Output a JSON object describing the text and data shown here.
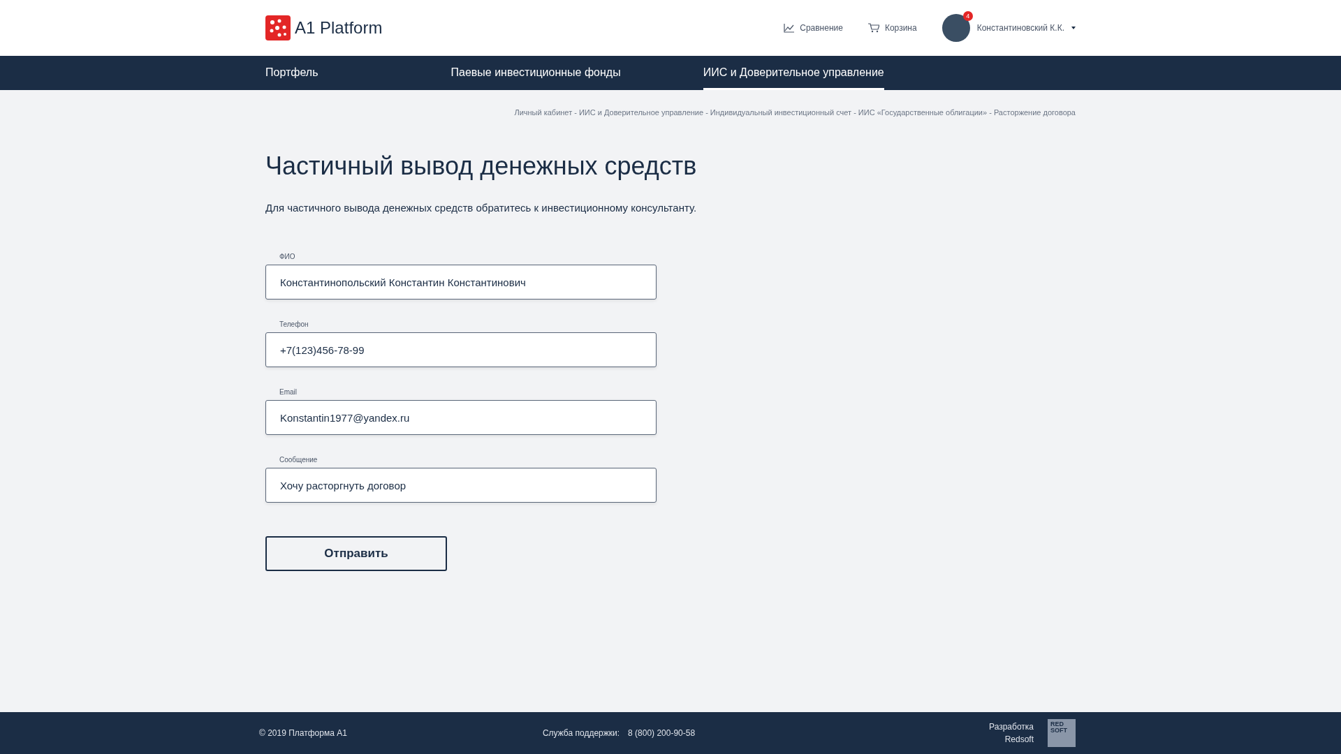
{
  "header": {
    "logo": "A1 Platform",
    "links": [
      {
        "kind": "chart",
        "label": "Сравнение"
      },
      {
        "kind": "cart",
        "label": "Корзина"
      }
    ],
    "user": {
      "name": "Константиновский К.К.",
      "badge": "4"
    }
  },
  "nav": [
    {
      "label": "Портфель",
      "selected": false
    },
    {
      "label": "Паевые инвестиционные фонды",
      "selected": false
    },
    {
      "label": "ИИС и Доверительное управление",
      "selected": true
    }
  ],
  "breadcrumbs": "Личный кабинет - ИИС и Доверительное управление - Индивидуальный инвестиционный счет - ИИС «Государственные облигации» - Расторжение договора",
  "title": "Частичный вывод денежных средств",
  "description": "Для частичного вывода денежных средств обратитесь к инвестиционному консультанту.",
  "fields": [
    {
      "label": "ФИО",
      "value": "Константинопольский Константин Константинович"
    },
    {
      "label": "Телефон",
      "value": "+7(123)456-78-99"
    },
    {
      "label": "Email",
      "value": "Konstantin1977@yandex.ru"
    },
    {
      "label": "Сообщение",
      "value": "Хочу расторгнуть договор"
    }
  ],
  "submit": "Отправить",
  "footer": {
    "copyright": "© 2019  Платформа А1",
    "support_label": "Служба поддержки:",
    "support_phone": "8 (800) 200-90-58",
    "developer": [
      "Разработка",
      "Redsoft"
    ],
    "developer_logo": [
      "RED",
      "SOFT"
    ]
  }
}
